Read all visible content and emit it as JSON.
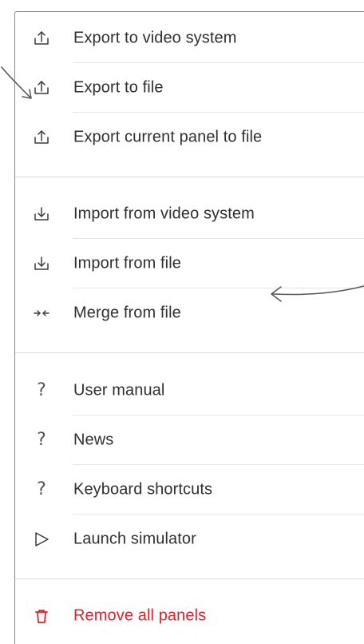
{
  "menu": {
    "export_group": [
      {
        "label": "Export to video system",
        "icon": "export-icon"
      },
      {
        "label": "Export to file",
        "icon": "export-icon"
      },
      {
        "label": "Export current panel to file",
        "icon": "export-icon"
      }
    ],
    "import_group": [
      {
        "label": "Import from video system",
        "icon": "import-icon"
      },
      {
        "label": "Import from file",
        "icon": "import-icon"
      },
      {
        "label": "Merge from file",
        "icon": "merge-icon"
      }
    ],
    "help_group": [
      {
        "label": "User manual",
        "icon": "help-icon",
        "glyph": "?"
      },
      {
        "label": "News",
        "icon": "help-icon",
        "glyph": "?"
      },
      {
        "label": "Keyboard shortcuts",
        "icon": "help-icon",
        "glyph": "?"
      },
      {
        "label": "Launch simulator",
        "icon": "play-icon"
      }
    ],
    "danger_group": [
      {
        "label": "Remove all panels",
        "icon": "trash-icon"
      }
    ]
  },
  "colors": {
    "text": "#2f2f2f",
    "icon": "#3b3b3b",
    "danger": "#d8232a",
    "divider": "#e6e6e6",
    "border": "#8a8a8a",
    "annotation": "#555555"
  }
}
